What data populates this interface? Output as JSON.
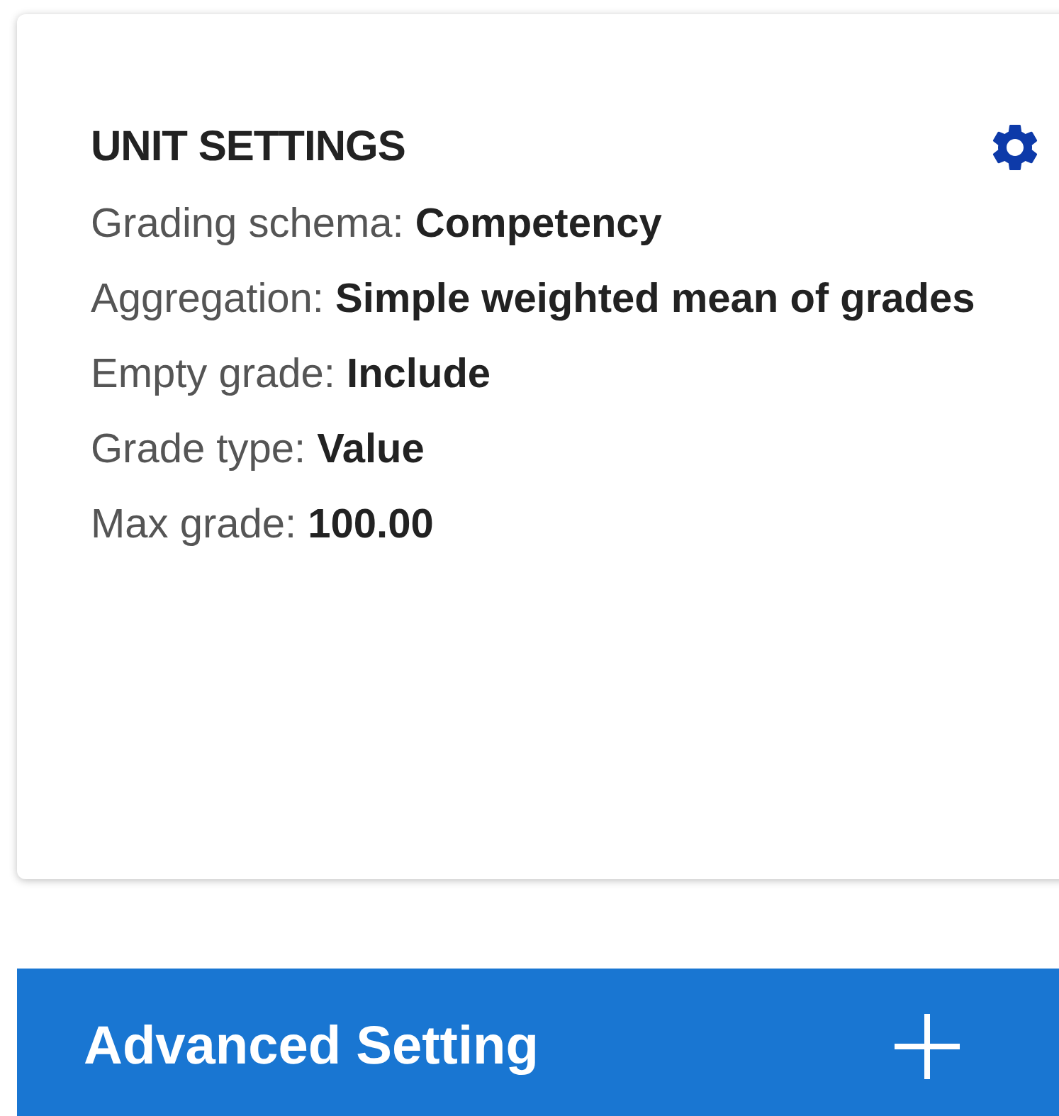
{
  "unit_settings": {
    "title": "UNIT SETTINGS",
    "rows": [
      {
        "label": "Grading schema:",
        "value": "Competency"
      },
      {
        "label": "Aggregation:",
        "value": "Simple weighted mean of grades"
      },
      {
        "label": "Empty grade:",
        "value": "Include"
      },
      {
        "label": "Grade type:",
        "value": "Value"
      },
      {
        "label": "Max grade:",
        "value": "100.00"
      }
    ]
  },
  "advanced_setting": {
    "label": "Advanced Setting"
  }
}
